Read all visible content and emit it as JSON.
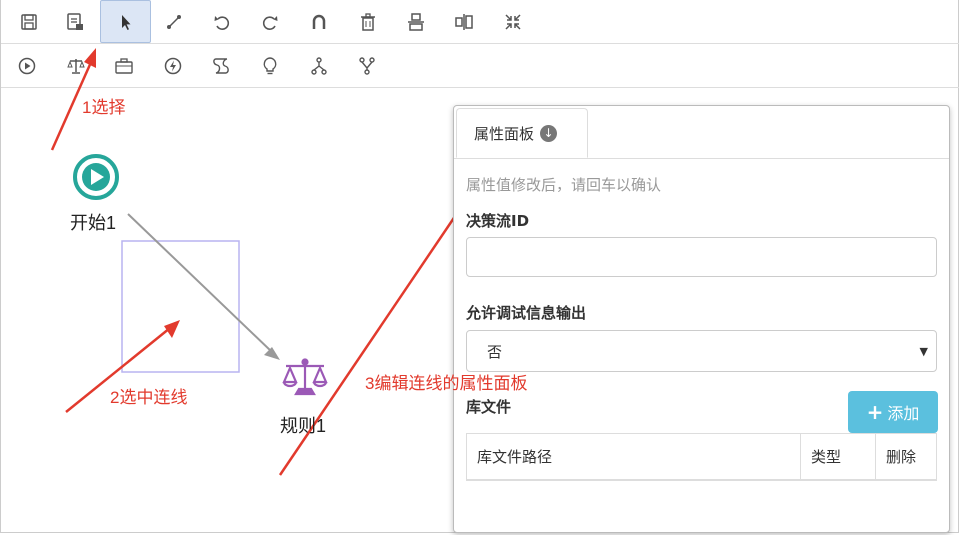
{
  "toolbar_row1": [
    {
      "name": "save-icon",
      "active": false
    },
    {
      "name": "save-as-icon",
      "active": false
    },
    {
      "name": "pointer-icon",
      "active": true
    },
    {
      "name": "connector-icon",
      "active": false
    },
    {
      "name": "undo-icon",
      "active": false
    },
    {
      "name": "redo-icon",
      "active": false
    },
    {
      "name": "magnet-icon",
      "active": false
    },
    {
      "name": "trash-icon",
      "active": false
    },
    {
      "name": "align-vertical-icon",
      "active": false
    },
    {
      "name": "align-horizontal-icon",
      "active": false
    },
    {
      "name": "compress-icon",
      "active": false
    }
  ],
  "toolbar_row2": [
    {
      "name": "play-circle-icon"
    },
    {
      "name": "scale-icon"
    },
    {
      "name": "briefcase-icon"
    },
    {
      "name": "bolt-circle-icon"
    },
    {
      "name": "script-icon"
    },
    {
      "name": "lightbulb-icon"
    },
    {
      "name": "fork-icon"
    },
    {
      "name": "branch-icon"
    }
  ],
  "canvas": {
    "start_node": {
      "label": "开始1",
      "icon": "play-circle-icon",
      "color": "#26a69a"
    },
    "rule_node": {
      "label": "规则1",
      "icon": "scale-icon",
      "color": "#9b59b6"
    },
    "connection_color": "#999999",
    "selection_color": "#b8b4f0"
  },
  "annotations": {
    "step1": "1选择",
    "step2": "2选中连线",
    "step3": "3编辑连线的属性面板",
    "color": "#e23a2d"
  },
  "panel": {
    "tab_label": "属性面板",
    "hint": "属性值修改后，请回车以确认",
    "fields": {
      "flow_id_label": "决策流ID",
      "flow_id_value": "",
      "debug_label": "允许调试信息输出",
      "debug_value": "否"
    },
    "lib_label": "库文件",
    "add_button": "添加",
    "add_button_color": "#5bc0de",
    "table_headers": [
      "库文件路径",
      "类型",
      "删除"
    ]
  }
}
